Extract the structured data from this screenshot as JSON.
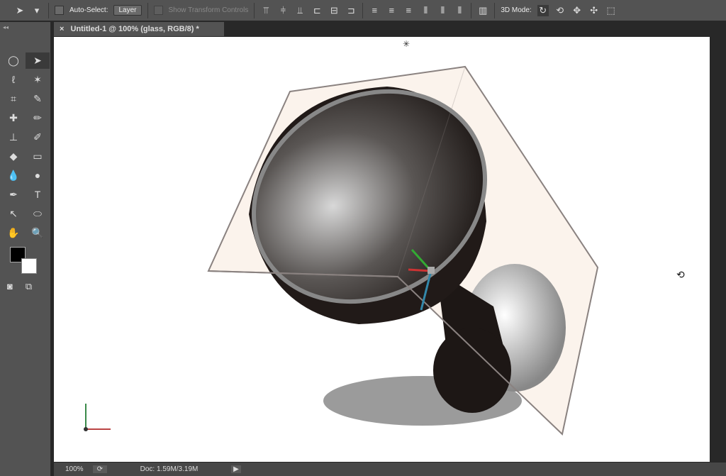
{
  "options_bar": {
    "auto_select_label": "Auto-Select:",
    "auto_select_value": "Layer",
    "show_transform_label": "Show Transform Controls",
    "mode_label": "3D Mode:"
  },
  "document_tab": {
    "close": "×",
    "title": "Untitled-1 @ 100% (glass, RGB/8) *"
  },
  "tools": [
    "marquee",
    "move",
    "lasso",
    "magic-wand",
    "crop",
    "eyedropper",
    "healing",
    "brush",
    "stamp",
    "history-brush",
    "eraser",
    "gradient",
    "blur",
    "dodge",
    "pen",
    "type",
    "path-select",
    "shape",
    "hand",
    "zoom"
  ],
  "status": {
    "zoom": "100%",
    "doc": "Doc: 1.59M/3.19M"
  }
}
